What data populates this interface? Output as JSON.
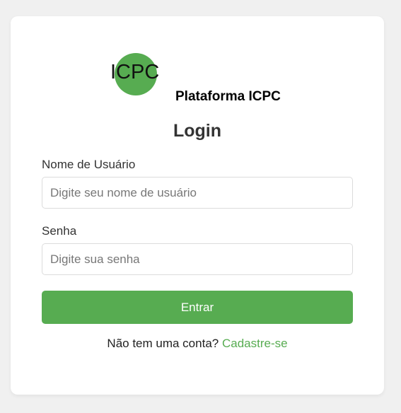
{
  "brand": {
    "logo_text": "ICPC",
    "platform_name": "Plataforma ICPC"
  },
  "form": {
    "title": "Login",
    "username_label": "Nome de Usuário",
    "username_placeholder": "Digite seu nome de usuário",
    "username_value": "",
    "password_label": "Senha",
    "password_placeholder": "Digite sua senha",
    "password_value": "",
    "submit_label": "Entrar"
  },
  "signup": {
    "prompt": "Não tem uma conta?",
    "link_label": "Cadastre-se"
  },
  "colors": {
    "accent": "#57ac51",
    "background": "#f0f0f0",
    "card": "#ffffff"
  }
}
